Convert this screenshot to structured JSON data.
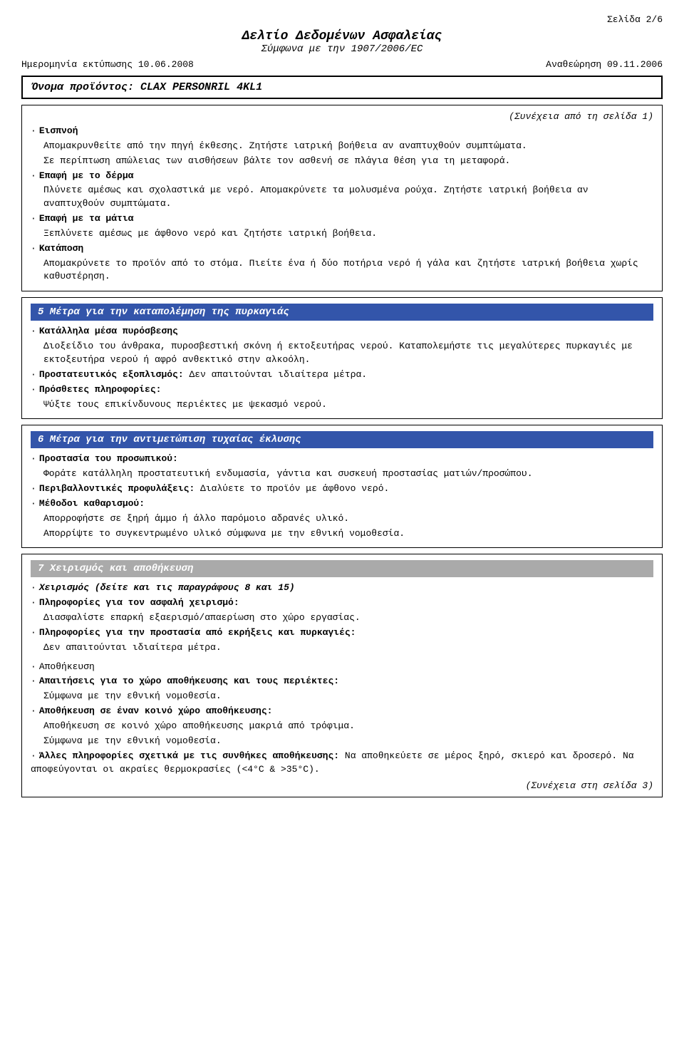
{
  "header": {
    "page_num": "Σελίδα 2/6",
    "doc_title": "Δελτίο Δεδομένων Ασφαλείας",
    "doc_subtitle": "Σύμφωνα με την 1907/2006/EC",
    "print_date_label": "Ημερομηνία εκτύπωσης",
    "print_date": "10.06.2008",
    "revision_label": "Αναθεώρηση",
    "revision_date": "09.11.2006"
  },
  "product": {
    "label": "Όνομα προϊόντος:",
    "name": "CLAX PERSONRIL 4KL1"
  },
  "continued_from": "(Συνέχεια από τη σελίδα 1)",
  "section4": {
    "content": [
      {
        "type": "bullet_heading",
        "heading": "Εισπνοή",
        "text": "Απομακρυνθείτε από την πηγή έκθεσης. Ζητήστε ιατρική βοήθεια αν αναπτυχθούν συμπτώματα."
      },
      {
        "type": "text",
        "text": "Σε περίπτωση απώλειας των αισθήσεων βάλτε τον ασθενή σε πλάγια θέση για τη μεταφορά."
      },
      {
        "type": "bullet_heading",
        "heading": "Επαφή με το δέρμα",
        "text": "Πλύνετε αμέσως και σχολαστικά με νερό. Απομακρύνετε τα μολυσμένα ρούχα. Ζητήστε ιατρική βοήθεια αν αναπτυχθούν συμπτώματα."
      },
      {
        "type": "bullet_heading",
        "heading": "Επαφή με τα μάτια",
        "text": "Ξεπλύνετε αμέσως με άφθονο νερό και ζητήστε ιατρική βοήθεια."
      },
      {
        "type": "bullet_heading",
        "heading": "Κατάποση",
        "text": "Απομακρύνετε το προϊόν από το στόμα. Πιείτε ένα ή δύο ποτήρια νερό ή γάλα και ζητήστε ιατρική βοήθεια χωρίς καθυστέρηση."
      }
    ]
  },
  "section5": {
    "header": "5 Μέτρα για την καταπολέμηση της πυρκαγιάς",
    "items": [
      {
        "type": "bullet_heading",
        "heading": "Κατάλληλα μέσα πυρόσβεσης",
        "text": "Διοξείδιο του άνθρακα, πυροσβεστική σκόνη ή εκτοξευτήρας νερού. Καταπολεμήστε τις μεγαλύτερες πυρκαγιές με εκτοξευτήρα νερού ή αφρό ανθεκτικό στην αλκοόλη."
      },
      {
        "type": "bullet_inline_bold",
        "heading": "Προστατευτικός εξοπλισμός:",
        "text": "Δεν απαιτούνται ιδιαίτερα μέτρα."
      },
      {
        "type": "bullet_heading",
        "heading": "Πρόσθετες πληροφορίες:",
        "text": "Ψύξτε τους επικίνδυνους περιέκτες με ψεκασμό νερού."
      }
    ]
  },
  "section6": {
    "header": "6 Μέτρα για την αντιμετώπιση τυχαίας έκλυσης",
    "items": [
      {
        "type": "bullet_heading_bold",
        "heading": "Προστασία του προσωπικού:",
        "text": "Φοράτε κατάλληλη προστατευτική ενδυμασία, γάντια και συσκευή προστασίας ματιών/προσώπου."
      },
      {
        "type": "bullet_inline_bold",
        "heading": "Περιβαλλοντικές προφυλάξεις:",
        "text": "Διαλύετε το προϊόν με άφθονο νερό."
      },
      {
        "type": "bullet_heading_bold",
        "heading": "Μέθοδοι καθαρισμού:",
        "text": "Απορροφήστε σε ξηρή άμμο ή άλλο παρόμοιο αδρανές υλικό. Απορρίψτε το συγκεντρωμένο υλικό σύμφωνα με την εθνική νομοθεσία."
      }
    ]
  },
  "section7": {
    "header": "7 Χειρισμός και αποθήκευση",
    "items": [
      {
        "type": "bullet_bold_italic",
        "text": "Χειρισμός (δείτε και τις παραγράφους 8 και 15)"
      },
      {
        "type": "bullet_heading_bold",
        "heading": "Πληροφορίες για τον ασφαλή χειρισμό:",
        "text": "Διασφαλίστε επαρκή εξαερισμό/απαερίωση στο χώρο εργασίας."
      },
      {
        "type": "bullet_heading_bold",
        "heading": "Πληροφορίες για την προστασία από εκρήξεις και πυρκαγιές:",
        "text": "Δεν απαιτούνται ιδιαίτερα μέτρα."
      },
      {
        "type": "spacer"
      },
      {
        "type": "bullet_plain",
        "text": "Αποθήκευση"
      },
      {
        "type": "bullet_heading_bold",
        "heading": "Απαιτήσεις για το χώρο αποθήκευσης και τους περιέκτες:",
        "text": "Σύμφωνα με την εθνική νομοθεσία."
      },
      {
        "type": "bullet_heading_bold",
        "heading": "Αποθήκευση σε έναν κοινό χώρο αποθήκευσης:",
        "text": "Αποθήκευση σε κοινό χώρο αποθήκευσης μακριά από τρόφιμα. Σύμφωνα με την εθνική νομοθεσία."
      },
      {
        "type": "bullet_heading_bold",
        "heading": "Άλλες πληροφορίες σχετικά με τις συνθήκες αποθήκευσης:",
        "text": "Να αποθηκεύετε σε μέρος ξηρό, σκιερό και δροσερό. Να αποφεύγονται οι ακραίες θερμοκρασίες (<4°C & >35°C)."
      }
    ]
  },
  "continued_next": "(Συνέχεια στη σελίδα 3)"
}
